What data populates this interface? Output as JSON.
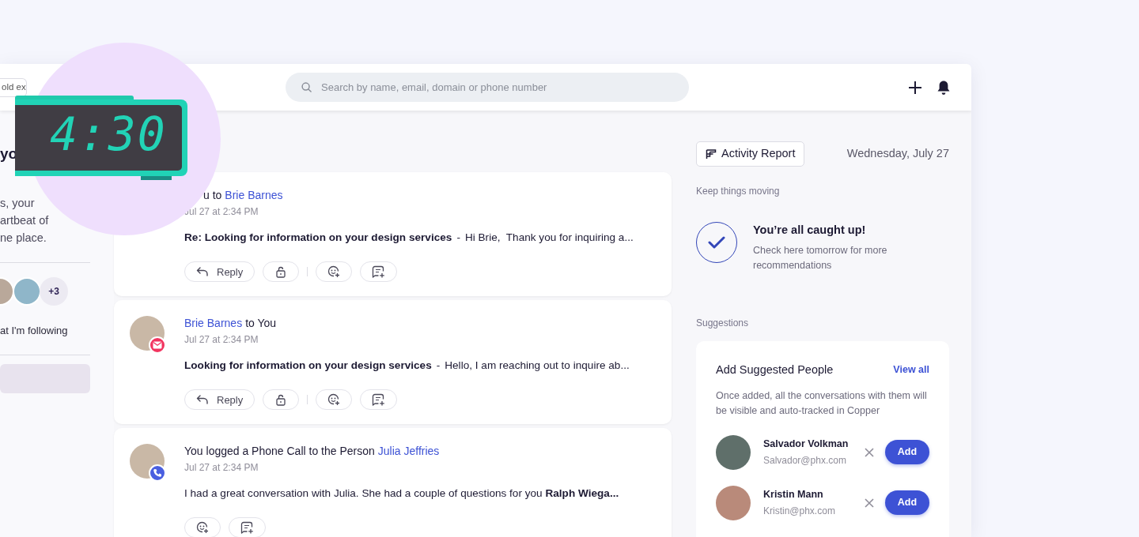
{
  "header": {
    "left_field_value": "old ex",
    "search_placeholder": "Search by name, email, domain or phone number"
  },
  "overlay": {
    "clock_time": "4:30"
  },
  "sidebar": {
    "heading": "yo",
    "description_lines": [
      "s, your",
      "artbeat of",
      "ne place."
    ],
    "avatar_more": "+3",
    "following_label": "at I'm following"
  },
  "feed": [
    {
      "title": [
        {
          "kind": "text",
          "text": "u to"
        },
        {
          "kind": "link",
          "text": "Brie Barnes"
        }
      ],
      "time": "Jul 27 at 2:34 PM",
      "subject": "Re: Looking for information on your design services",
      "separator": "-",
      "preview": "Hi Brie,  Thank you for inquiring a...",
      "actions": [
        {
          "kind": "reply",
          "label": "Reply"
        },
        {
          "kind": "lock"
        },
        {
          "kind": "divider"
        },
        {
          "kind": "emoji"
        },
        {
          "kind": "note"
        }
      ]
    },
    {
      "kind": "email",
      "title": [
        {
          "kind": "link",
          "text": "Brie Barnes"
        },
        {
          "kind": "text",
          "text": "to You"
        }
      ],
      "time": "Jul 27 at 2:34 PM",
      "subject": "Looking for information on your design services",
      "separator": "-",
      "preview": "Hello, I am reaching out to inquire ab...",
      "actions": [
        {
          "kind": "reply",
          "label": "Reply"
        },
        {
          "kind": "lock"
        },
        {
          "kind": "divider"
        },
        {
          "kind": "emoji"
        },
        {
          "kind": "note"
        }
      ]
    },
    {
      "kind": "phone",
      "title": [
        {
          "kind": "text",
          "text": "You logged a Phone Call to the Person"
        },
        {
          "kind": "link",
          "text": "Julia Jeffries"
        }
      ],
      "time": "Jul 27 at 2:34 PM",
      "body": "I had a great conversation with Julia. She had a couple of questions for you **Ralph Wiega...**",
      "actions": [
        {
          "kind": "emoji"
        },
        {
          "kind": "note"
        }
      ]
    }
  ],
  "right_panel": {
    "report_button": "Activity Report",
    "date": "Wednesday, July 27",
    "keep_moving_label": "Keep things moving",
    "caught_up_title": "You’re all caught up!",
    "caught_up_text": "Check here tomorrow for more recommendations",
    "suggestions_label": "Suggestions",
    "suggestion_card": {
      "title": "Add Suggested People",
      "view_all": "View all",
      "description": "Once added, all the conversations with them will be visible and auto-tracked in Copper",
      "people": [
        {
          "name": "Salvador Volkman",
          "email": "Salvador@phx.com",
          "add_label": "Add"
        },
        {
          "name": "Kristin Mann",
          "email": "Kristin@phx.com",
          "add_label": "Add"
        }
      ]
    }
  }
}
